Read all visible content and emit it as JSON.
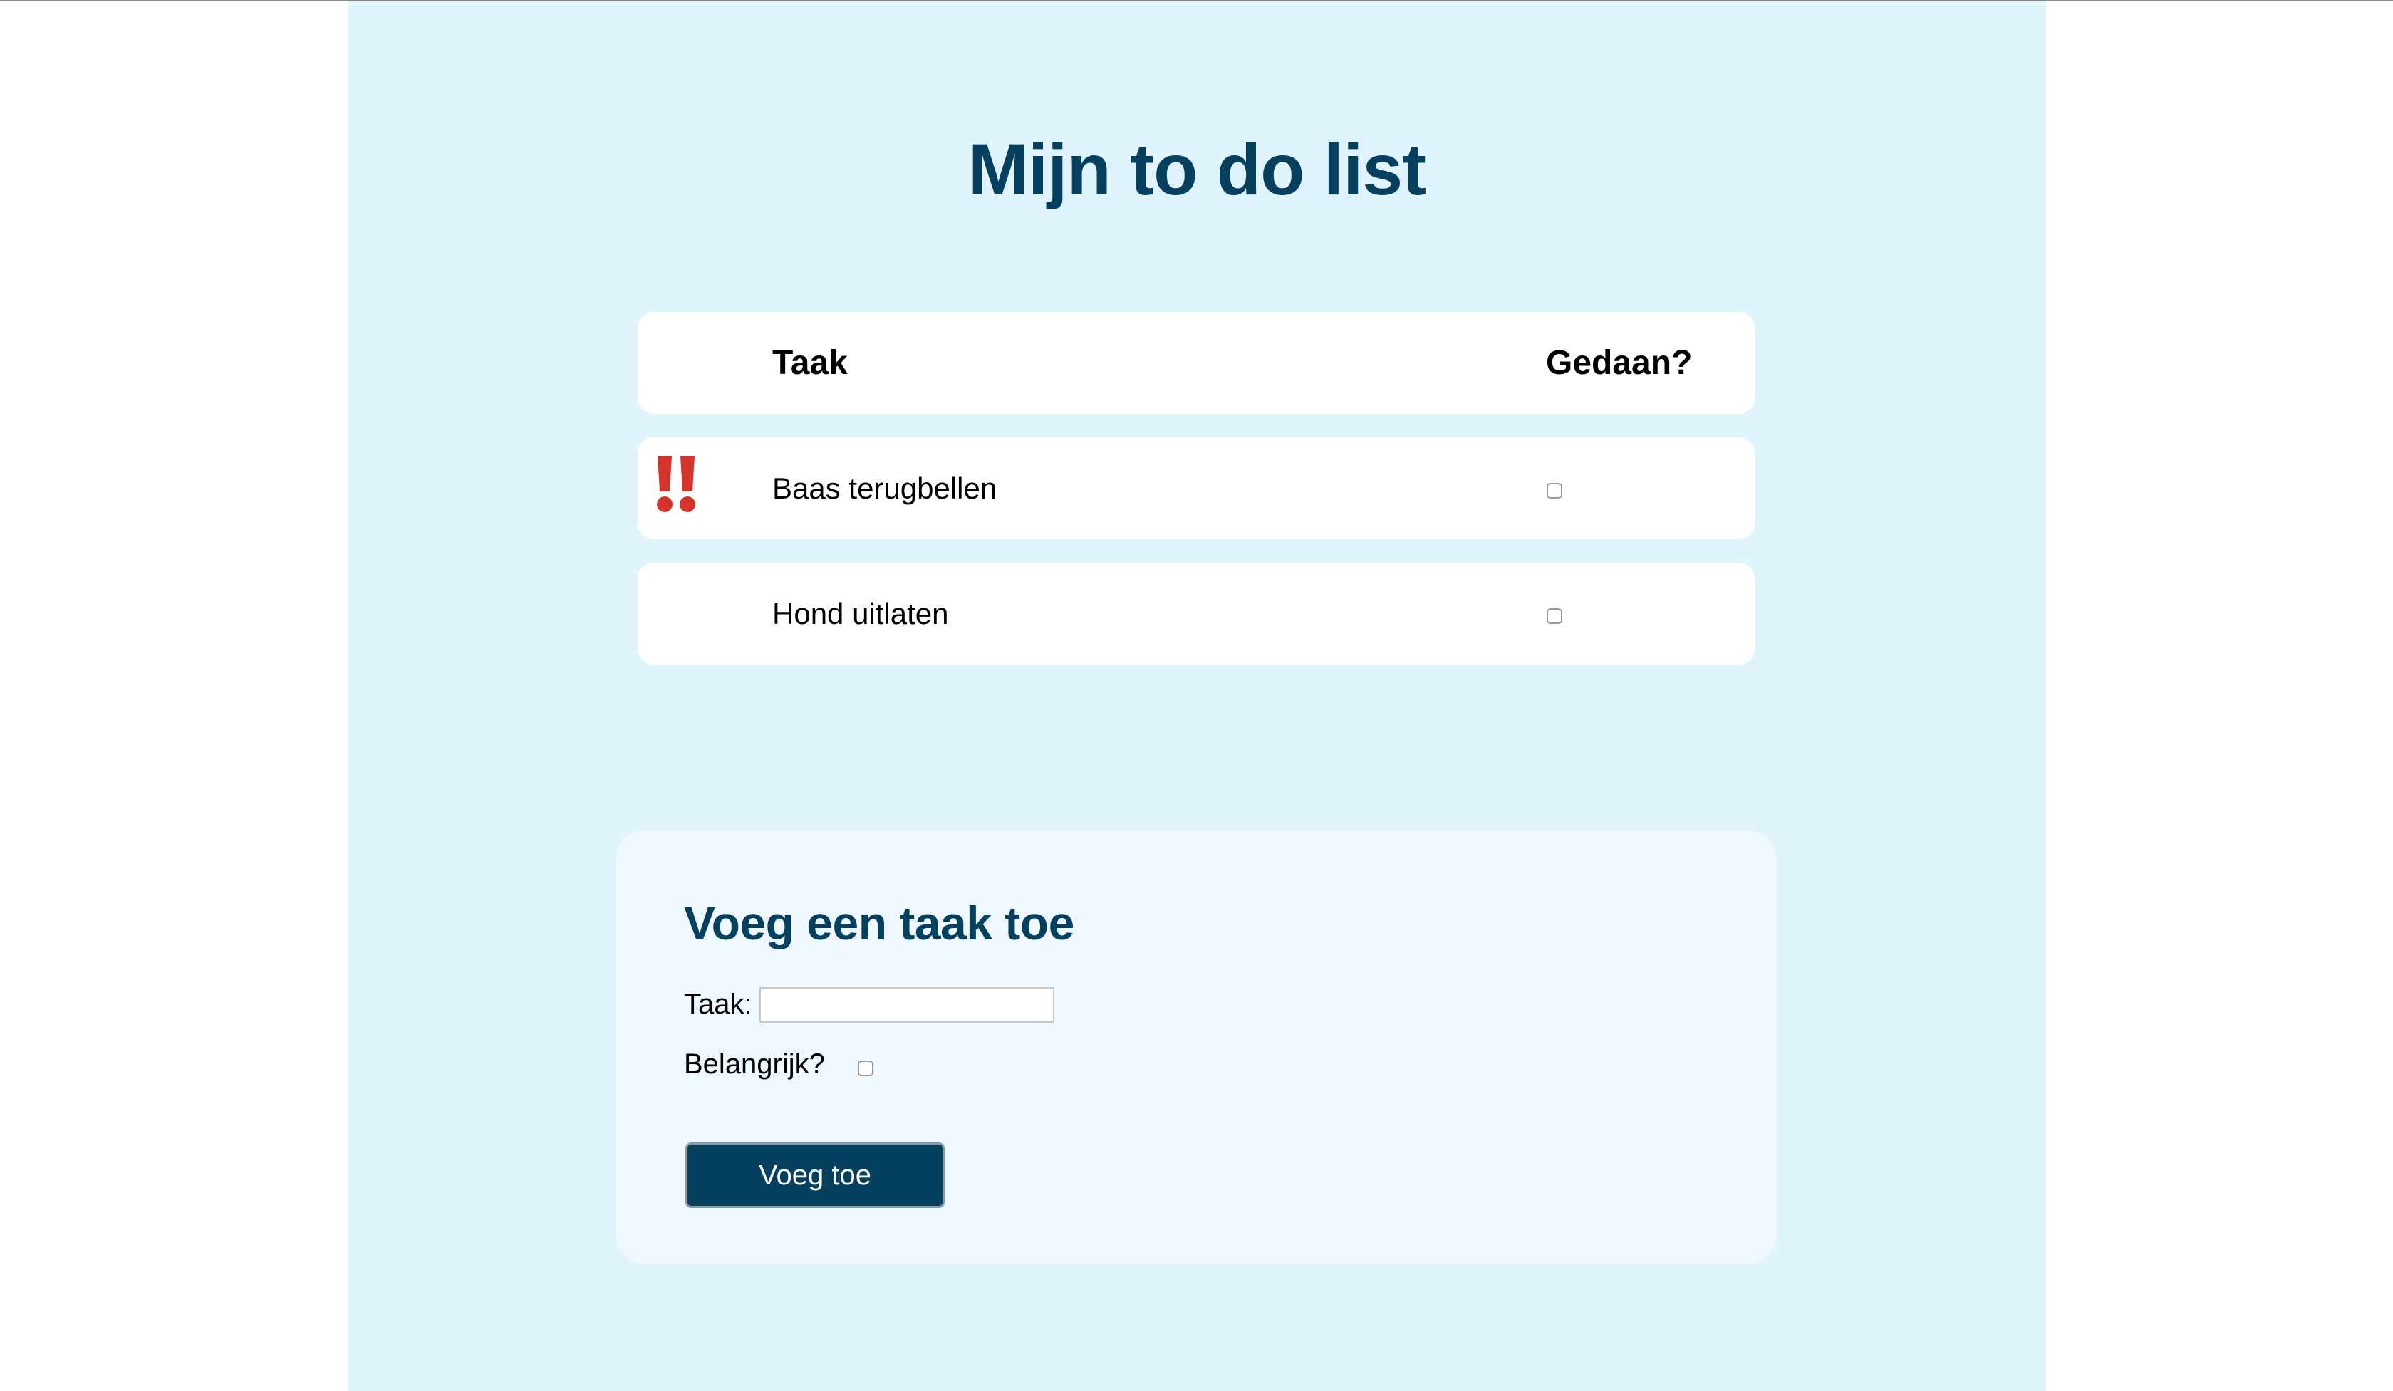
{
  "page": {
    "title": "Mijn to do list"
  },
  "table": {
    "headers": {
      "task": "Taak",
      "done": "Gedaan?"
    },
    "rows": [
      {
        "task": "Baas terugbellen",
        "important": true,
        "done": false
      },
      {
        "task": "Hond uitlaten",
        "important": false,
        "done": false
      }
    ]
  },
  "form": {
    "title": "Voeg een taak toe",
    "task_label": "Taak:",
    "task_value": "",
    "important_label": "Belangrijk?",
    "important_checked": false,
    "submit_label": "Voeg toe"
  },
  "colors": {
    "page_background": "#e0f4fd",
    "heading": "#06405f",
    "important_icon": "#d3332b",
    "button": "#06405f"
  },
  "icons": {
    "important": "double-exclamation-icon"
  }
}
